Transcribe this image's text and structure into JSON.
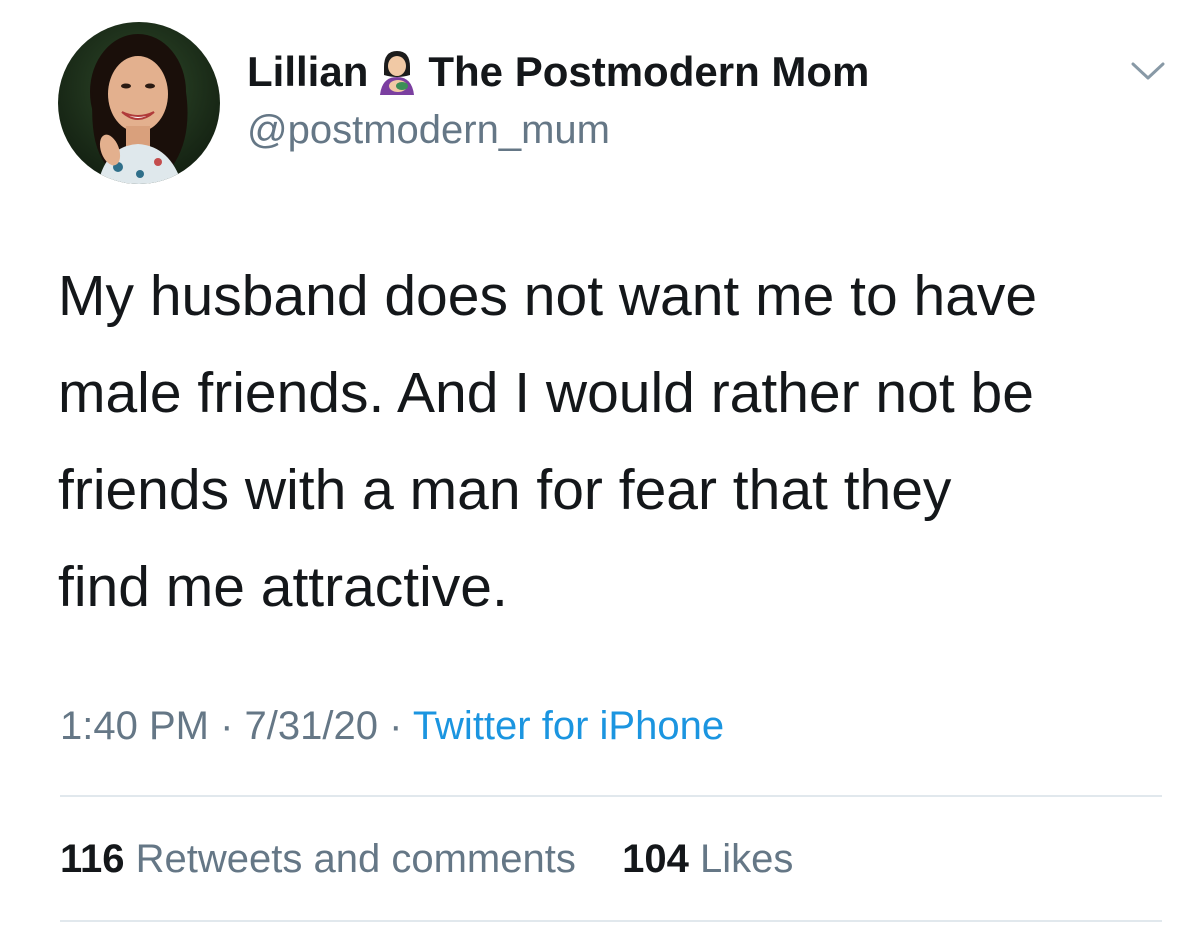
{
  "user": {
    "name": "Lillian",
    "name_emoji": "woman-feeding-baby-emoji",
    "name_suffix": "The Postmodern Mom",
    "handle": "@postmodern_mum"
  },
  "tweet": {
    "text": "My husband does not want me to have\nmale friends. And I would rather not be\nfriends with a man for fear that they\nfind me attractive."
  },
  "meta": {
    "time": "1:40 PM",
    "sep1": " · ",
    "date": "7/31/20",
    "sep2": " · ",
    "source": "Twitter for iPhone"
  },
  "stats": {
    "retweets_count": "116",
    "retweets_label": "Retweets and comments",
    "likes_count": "104",
    "likes_label": "Likes"
  },
  "colors": {
    "text": "#14171a",
    "secondary": "#657786",
    "link": "#1b95e0",
    "divider": "#e1e8ed"
  }
}
